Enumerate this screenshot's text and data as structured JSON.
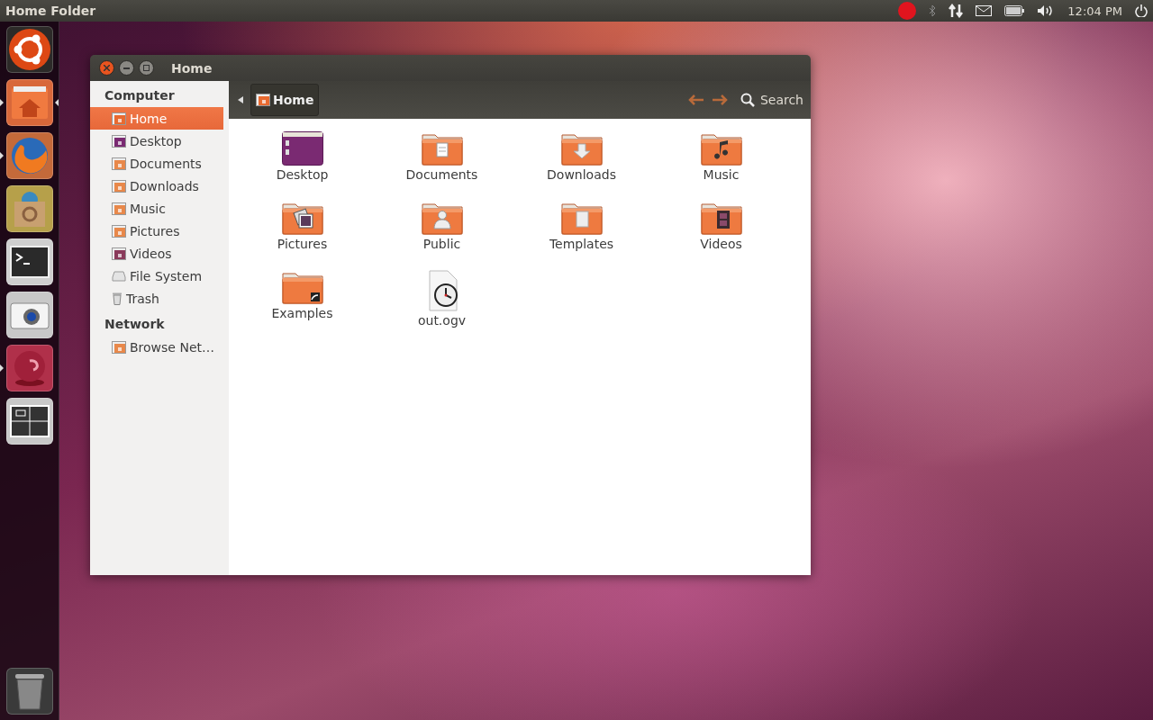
{
  "top_panel": {
    "title": "Home Folder",
    "clock": "12:04 PM",
    "recording": true
  },
  "launcher": [
    {
      "kind": "ubuntu",
      "running": false,
      "focused": false
    },
    {
      "kind": "home",
      "running": true,
      "focused": true
    },
    {
      "kind": "browser",
      "running": true,
      "focused": false
    },
    {
      "kind": "store",
      "running": false,
      "focused": false
    },
    {
      "kind": "terminal",
      "running": false,
      "focused": false
    },
    {
      "kind": "camera",
      "running": false,
      "focused": false
    },
    {
      "kind": "red",
      "running": true,
      "focused": false
    },
    {
      "kind": "workspaces",
      "running": false,
      "focused": false
    }
  ],
  "window": {
    "title": "Home",
    "sidebar": [
      {
        "heading": "Computer",
        "items": [
          {
            "label": "Home",
            "kind": "home",
            "selected": true
          },
          {
            "label": "Desktop",
            "kind": "desktop",
            "selected": false
          },
          {
            "label": "Documents",
            "kind": "documents",
            "selected": false
          },
          {
            "label": "Downloads",
            "kind": "downloads",
            "selected": false
          },
          {
            "label": "Music",
            "kind": "music",
            "selected": false
          },
          {
            "label": "Pictures",
            "kind": "pictures",
            "selected": false
          },
          {
            "label": "Videos",
            "kind": "videos",
            "selected": false
          },
          {
            "label": "File System",
            "kind": "drive",
            "selected": false
          },
          {
            "label": "Trash",
            "kind": "trash",
            "selected": false
          }
        ]
      },
      {
        "heading": "Network",
        "items": [
          {
            "label": "Browse Net…",
            "kind": "network",
            "selected": false
          }
        ]
      }
    ],
    "path": "Home",
    "search": "Search",
    "files": [
      {
        "name": "Desktop",
        "kind": "desktop"
      },
      {
        "name": "Documents",
        "kind": "documents"
      },
      {
        "name": "Downloads",
        "kind": "downloads"
      },
      {
        "name": "Music",
        "kind": "music"
      },
      {
        "name": "Pictures",
        "kind": "pictures"
      },
      {
        "name": "Public",
        "kind": "public"
      },
      {
        "name": "Templates",
        "kind": "templates"
      },
      {
        "name": "Videos",
        "kind": "videos"
      },
      {
        "name": "Examples",
        "kind": "examples"
      },
      {
        "name": "out.ogv",
        "kind": "video-file"
      }
    ]
  }
}
